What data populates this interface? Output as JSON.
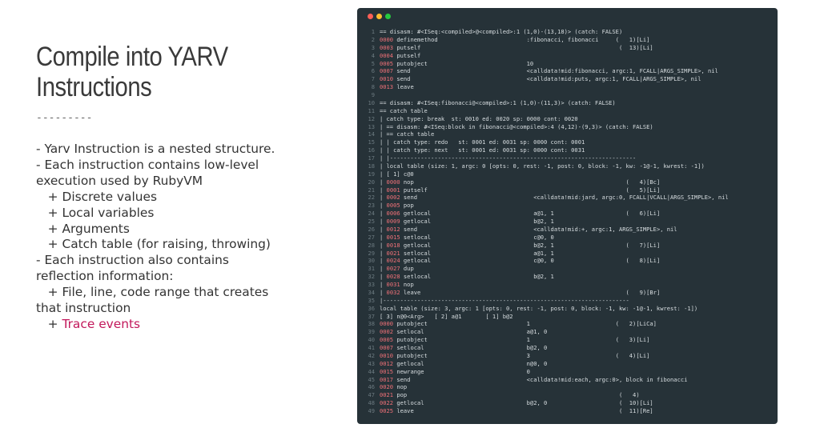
{
  "slide": {
    "title_line1": "Compile into YARV",
    "title_line2": "Instructions",
    "divider": "---------",
    "bullets": [
      "- Yarv Instruction is a nested structure.",
      "- Each instruction contains low-level",
      "execution used by RubyVM",
      "   + Discrete values",
      "   + Local variables",
      "   + Arguments",
      "   + Catch table (for raising, throwing)",
      "",
      "- Each instruction also contains",
      "reflection information:",
      "   + File, line, code range that creates",
      "that instruction"
    ],
    "last_bullet_prefix": "   + ",
    "last_bullet_accent": "Trace events",
    "accent_color": "#c2185b"
  },
  "terminal": {
    "buttons": [
      "close",
      "minimize",
      "maximize"
    ],
    "lines": [
      "== disasm: #<ISeq:<compiled>@<compiled>:1 (1,0)-(13,18)> (catch: FALSE)",
      "0000 definemethod                          :fibonacci, fibonacci     (   1)[Li]",
      "0003 putself                                                          (  13)[Li]",
      "0004 putself",
      "0005 putobject                             10",
      "0007 send                                  <calldata!mid:fibonacci, argc:1, FCALL|ARGS_SIMPLE>, nil",
      "0010 send                                  <calldata!mid:puts, argc:1, FCALL|ARGS_SIMPLE>, nil",
      "0013 leave",
      "",
      "== disasm: #<ISeq:fibonacci@<compiled>:1 (1,0)-(11,3)> (catch: FALSE)",
      "== catch table",
      "| catch type: break  st: 0010 ed: 0020 sp: 0000 cont: 0020",
      "| == disasm: #<ISeq:block in fibonacci@<compiled>:4 (4,12)-(9,3)> (catch: FALSE)",
      "| == catch table",
      "| | catch type: redo   st: 0001 ed: 0031 sp: 0000 cont: 0001",
      "| | catch type: next   st: 0001 ed: 0031 sp: 0000 cont: 0031",
      "| |------------------------------------------------------------------------",
      "| local table (size: 1, argc: 0 [opts: 0, rest: -1, post: 0, block: -1, kw: -1@-1, kwrest: -1])",
      "| [ 1] c@0",
      "| 0000 nop                                                              (   4)[Bc]",
      "| 0001 putself                                                          (   5)[Li]",
      "| 0002 send                                  <calldata!mid:jard, argc:0, FCALL|VCALL|ARGS_SIMPLE>, nil",
      "| 0005 pop",
      "| 0006 getlocal                              a@1, 1                     (   6)[Li]",
      "| 0009 getlocal                              b@2, 1",
      "| 0012 send                                  <calldata!mid:+, argc:1, ARGS_SIMPLE>, nil",
      "| 0015 setlocal                              c@0, 0",
      "| 0018 getlocal                              b@2, 1                     (   7)[Li]",
      "| 0021 setlocal                              a@1, 1",
      "| 0024 getlocal                              c@0, 0                     (   8)[Li]",
      "| 0027 dup",
      "| 0028 setlocal                              b@2, 1",
      "| 0031 nop",
      "| 0032 leave                                                            (   9)[Br]",
      "|------------------------------------------------------------------------",
      "local table (size: 3, argc: 1 [opts: 0, rest: -1, post: 0, block: -1, kw: -1@-1, kwrest: -1])",
      "[ 3] n@0<Arg>   [ 2] a@1       [ 1] b@2",
      "0000 putobject                             1                         (   2)[LiCa]",
      "0002 setlocal                              a@1, 0",
      "0005 putobject                             1                         (   3)[Li]",
      "0007 setlocal                              b@2, 0",
      "0010 putobject                             3                         (   4)[Li]",
      "0012 getlocal                              n@0, 0",
      "0015 newrange                              0",
      "0017 send                                  <calldata!mid:each, argc:0>, block in fibonacci",
      "0020 nop",
      "0021 pop                                                              (   4)",
      "0022 getlocal                              b@2, 0                     (  10)[Li]",
      "0025 leave                                                            (  11)[Re]"
    ]
  }
}
